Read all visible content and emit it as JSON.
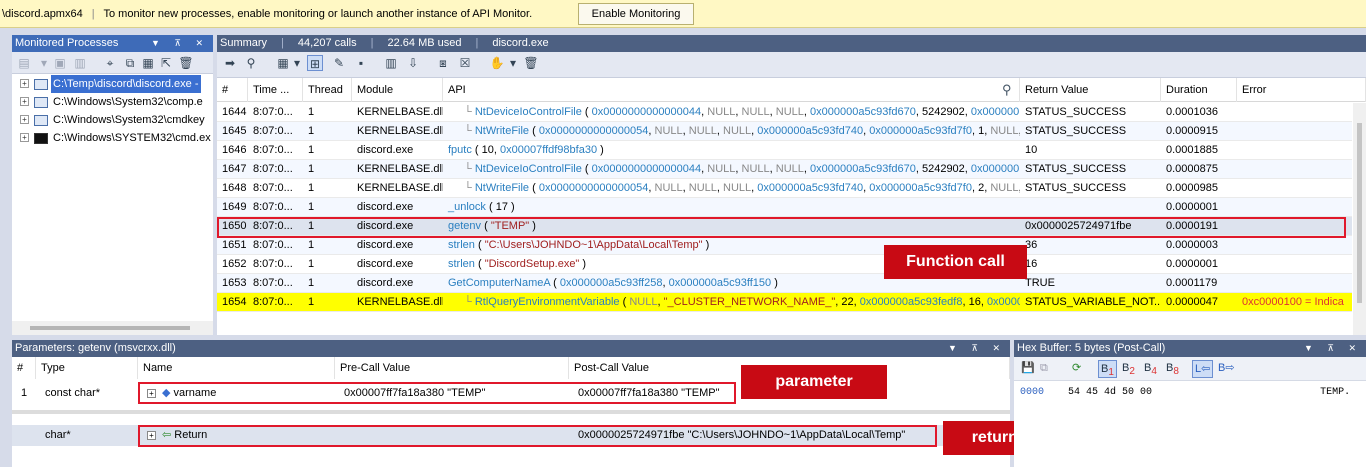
{
  "notice": {
    "process": "\\discord.apmx64",
    "separator": "|",
    "message": "To monitor new processes, enable monitoring or launch another instance of API Monitor.",
    "button": "Enable Monitoring"
  },
  "monitored": {
    "title": "Monitored Processes",
    "items": [
      {
        "label": "C:\\Temp\\discord\\discord.exe -",
        "icon": "window-icon"
      },
      {
        "label": "C:\\Windows\\System32\\comp.e",
        "icon": "window-icon"
      },
      {
        "label": "C:\\Windows\\System32\\cmdkey",
        "icon": "window-icon"
      },
      {
        "label": "C:\\Windows\\SYSTEM32\\cmd.ex",
        "icon": "cmd-icon"
      }
    ]
  },
  "summary": {
    "title": "Summary",
    "calls": "44,207 calls",
    "memory": "22.64 MB used",
    "process": "discord.exe",
    "separator": "|"
  },
  "grid": {
    "columns": [
      "#",
      "Time ...",
      "Thread",
      "Module",
      "API",
      "Return Value",
      "Duration",
      "Error"
    ],
    "rows": [
      {
        "n": "1644",
        "time": "8:07:0...",
        "thread": "1",
        "module": "KERNELBASE.dll",
        "fn": "NtDeviceIoControlFile",
        "args": "( 0x0000000000000044, NULL, NULL, NULL, 0x000000a5c93fd670, 5242902, 0x000000...",
        "ret": "STATUS_SUCCESS",
        "dur": "0.0001036",
        "err": "",
        "nested": true
      },
      {
        "n": "1645",
        "time": "8:07:0...",
        "thread": "1",
        "module": "KERNELBASE.dll",
        "fn": "NtWriteFile",
        "args": "( 0x0000000000000054, NULL, NULL, NULL, 0x000000a5c93fd740, 0x000000a5c93fd7f0, 1, NULL, N",
        "ret": "STATUS_SUCCESS",
        "dur": "0.0000915",
        "err": "",
        "nested": true
      },
      {
        "n": "1646",
        "time": "8:07:0...",
        "thread": "1",
        "module": "discord.exe",
        "fn": "fputc",
        "args": "( 10, 0x00007ffdf98bfa30 )",
        "ret": "10",
        "dur": "0.0001885",
        "err": "",
        "nested": false
      },
      {
        "n": "1647",
        "time": "8:07:0...",
        "thread": "1",
        "module": "KERNELBASE.dll",
        "fn": "NtDeviceIoControlFile",
        "args": "( 0x0000000000000044, NULL, NULL, NULL, 0x000000a5c93fd670, 5242902, 0x000000...",
        "ret": "STATUS_SUCCESS",
        "dur": "0.0000875",
        "err": "",
        "nested": true
      },
      {
        "n": "1648",
        "time": "8:07:0...",
        "thread": "1",
        "module": "KERNELBASE.dll",
        "fn": "NtWriteFile",
        "args": "( 0x0000000000000054, NULL, NULL, NULL, 0x000000a5c93fd740, 0x000000a5c93fd7f0, 2, NULL, N",
        "ret": "STATUS_SUCCESS",
        "dur": "0.0000985",
        "err": "",
        "nested": true
      },
      {
        "n": "1649",
        "time": "8:07:0...",
        "thread": "1",
        "module": "discord.exe",
        "fn": "_unlock",
        "args": "( 17 )",
        "ret": "",
        "dur": "0.0000001",
        "err": "",
        "nested": false
      },
      {
        "n": "1650",
        "time": "8:07:0...",
        "thread": "1",
        "module": "discord.exe",
        "fn": "getenv",
        "args": "( \"TEMP\" )",
        "ret": "0x0000025724971fbe",
        "dur": "0.0000191",
        "err": "",
        "nested": false
      },
      {
        "n": "1651",
        "time": "8:07:0...",
        "thread": "1",
        "module": "discord.exe",
        "fn": "strlen",
        "args": "( \"C:\\Users\\JOHNDO~1\\AppData\\Local\\Temp\" )",
        "ret": "36",
        "dur": "0.0000003",
        "err": "",
        "nested": false
      },
      {
        "n": "1652",
        "time": "8:07:0...",
        "thread": "1",
        "module": "discord.exe",
        "fn": "strlen",
        "args": "( \"DiscordSetup.exe\" )",
        "ret": "16",
        "dur": "0.0000001",
        "err": "",
        "nested": false
      },
      {
        "n": "1653",
        "time": "8:07:0...",
        "thread": "1",
        "module": "discord.exe",
        "fn": "GetComputerNameA",
        "args": "( 0x000000a5c93ff258, 0x000000a5c93ff150 )",
        "ret": "TRUE",
        "dur": "0.0001179",
        "err": "",
        "nested": false
      },
      {
        "n": "1654",
        "time": "8:07:0...",
        "thread": "1",
        "module": "KERNELBASE.dll",
        "fn": "RtlQueryEnvironmentVariable",
        "args": "( NULL, \"_CLUSTER_NETWORK_NAME_\", 22, 0x000000a5c93fedf8, 16, 0x0000...",
        "ret": "STATUS_VARIABLE_NOT...",
        "dur": "0.0000047",
        "err": "0xc0000100 = Indica",
        "nested": true
      }
    ]
  },
  "annotations": {
    "function_call": "Function call",
    "parameter": "parameter",
    "return_value": "return value"
  },
  "params": {
    "title": "Parameters: getenv (msvcrxx.dll)",
    "columns": [
      "#",
      "Type",
      "Name",
      "Pre-Call Value",
      "Post-Call Value"
    ],
    "rows": [
      {
        "n": "1",
        "type": "const char*",
        "name": "varname",
        "pre": "0x00007ff7fa18a380 \"TEMP\"",
        "post": "0x00007ff7fa18a380 \"TEMP\""
      }
    ],
    "return_row": {
      "type": "char*",
      "name": "Return",
      "post": "0x0000025724971fbe \"C:\\Users\\JOHNDO~1\\AppData\\Local\\Temp\""
    }
  },
  "hex": {
    "title": "Hex Buffer: 5 bytes (Post-Call)",
    "buttons": {
      "b1": "1",
      "b2": "2",
      "b4": "4",
      "b8": "8",
      "b1_prefix": "B",
      "b2_prefix": "B",
      "b4_prefix": "B",
      "b8_prefix": "B",
      "order_b": "B"
    },
    "offset": "0000",
    "bytes": "54 45 4d 50 00",
    "ascii": "TEMP."
  }
}
